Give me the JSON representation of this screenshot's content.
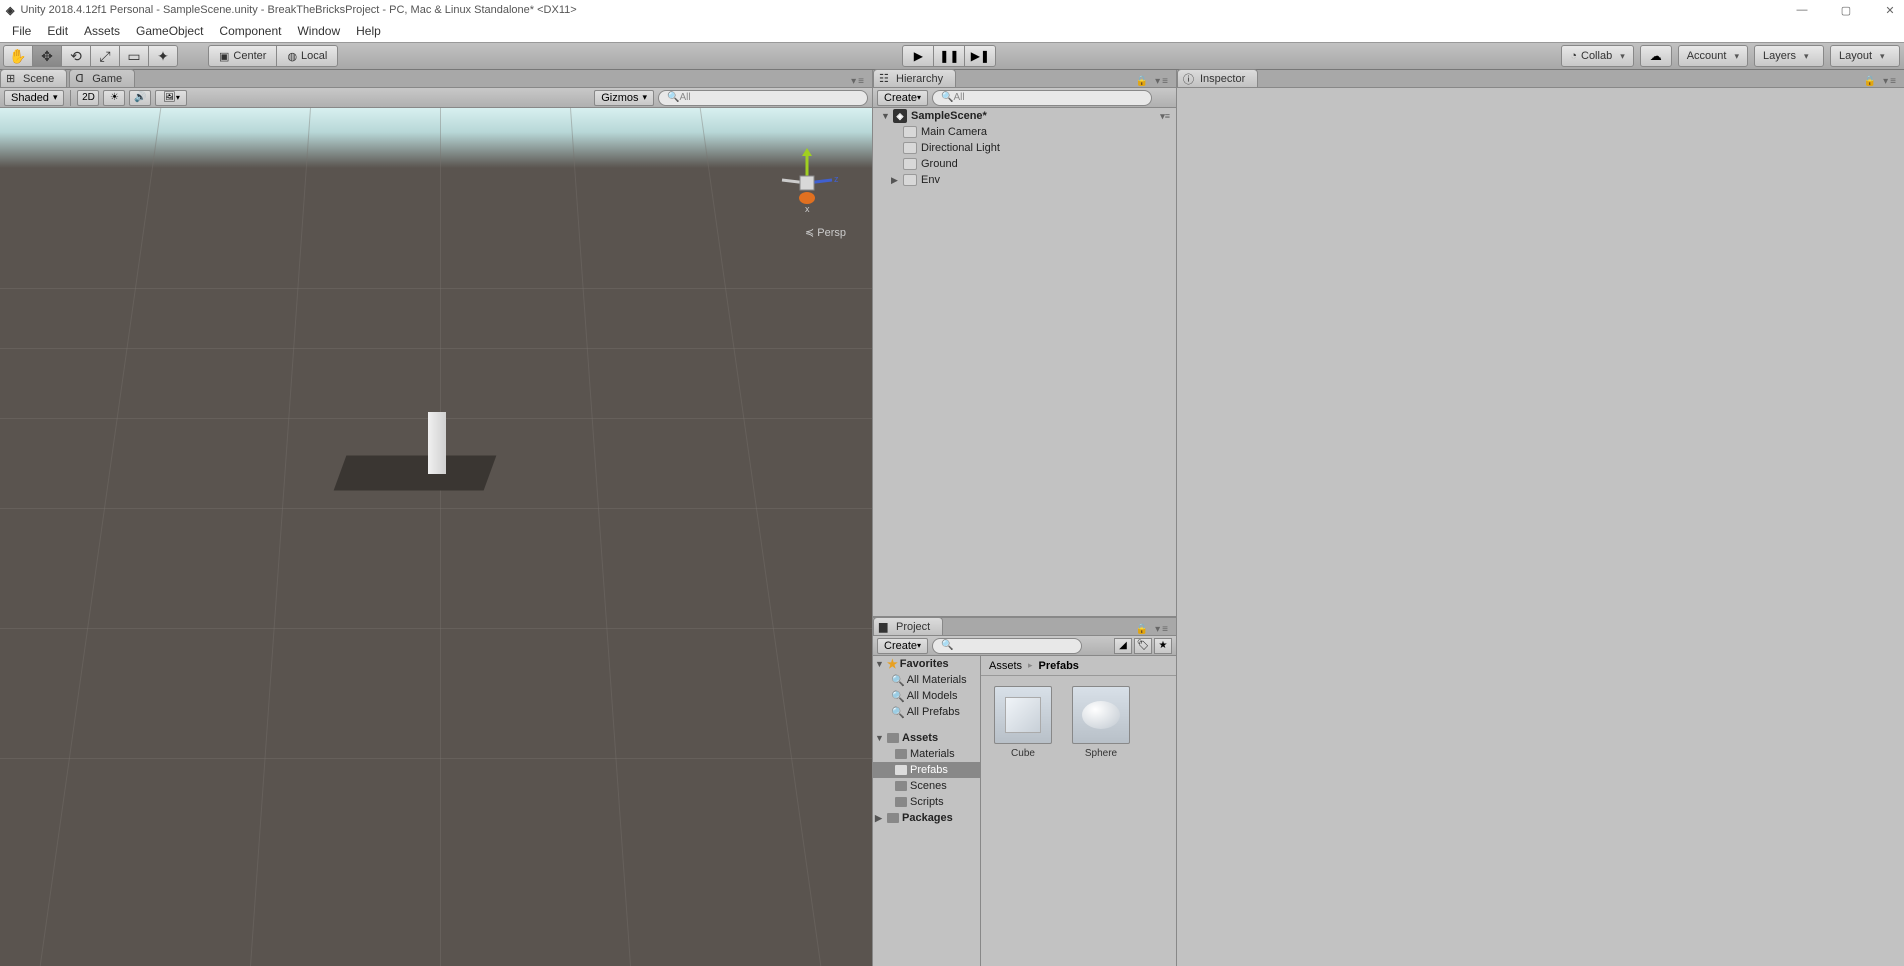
{
  "title": "Unity 2018.4.12f1 Personal - SampleScene.unity - BreakTheBricksProject - PC, Mac & Linux Standalone* <DX11>",
  "menu": [
    "File",
    "Edit",
    "Assets",
    "GameObject",
    "Component",
    "Window",
    "Help"
  ],
  "toolbar": {
    "pivot": "Center",
    "space": "Local",
    "collab": "Collab",
    "account": "Account",
    "layers": "Layers",
    "layout": "Layout"
  },
  "tabs": {
    "scene": "Scene",
    "game": "Game",
    "hierarchy": "Hierarchy",
    "project": "Project",
    "inspector": "Inspector"
  },
  "sceneBar": {
    "shaded": "Shaded",
    "twoD": "2D",
    "gizmos": "Gizmos",
    "searchPlaceholder": "All",
    "persp": "Persp"
  },
  "hierarchy": {
    "create": "Create",
    "searchPlaceholder": "All",
    "scene": "SampleScene*",
    "items": [
      "Main Camera",
      "Directional Light",
      "Ground",
      "Env"
    ]
  },
  "project": {
    "create": "Create",
    "favorites": "Favorites",
    "favItems": [
      "All Materials",
      "All Models",
      "All Prefabs"
    ],
    "assets": "Assets",
    "assetFolders": [
      "Materials",
      "Prefabs",
      "Scenes",
      "Scripts"
    ],
    "packages": "Packages",
    "breadcrumb": [
      "Assets",
      "Prefabs"
    ],
    "gridItems": [
      {
        "name": "Cube"
      },
      {
        "name": "Sphere"
      }
    ]
  },
  "gizmo": {
    "x": "x",
    "z": "z"
  }
}
